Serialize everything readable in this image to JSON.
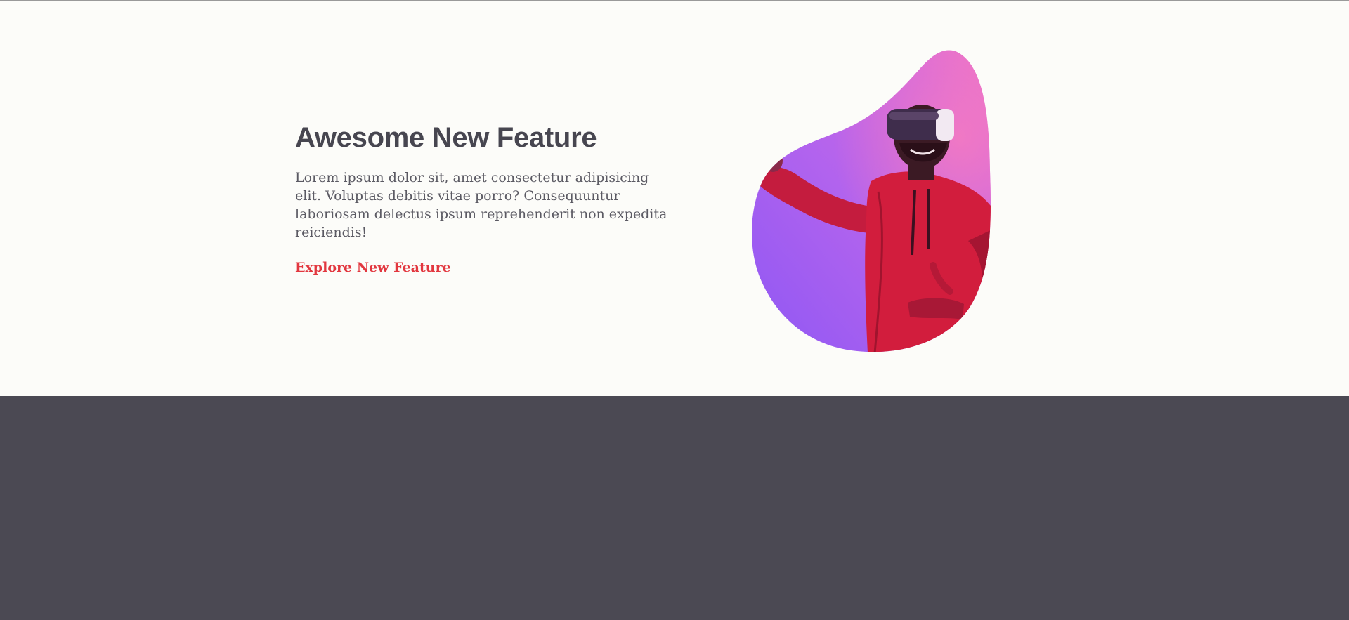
{
  "hero": {
    "headline": "Awesome New Feature",
    "body": "Lorem ipsum dolor sit, amet consectetur adipisicing elit. Voluptas debitis vitae porro? Consequuntur laboriosam delectus ipsum reprehenderit non expedita reiciendis!",
    "cta_label": "Explore New Feature",
    "image_subject": "person wearing VR headset in red hoodie"
  },
  "colors": {
    "background": "#fcfcf9",
    "heading": "#474650",
    "body_text": "#5b5a63",
    "accent": "#e2373f",
    "footer": "#4b4953"
  }
}
